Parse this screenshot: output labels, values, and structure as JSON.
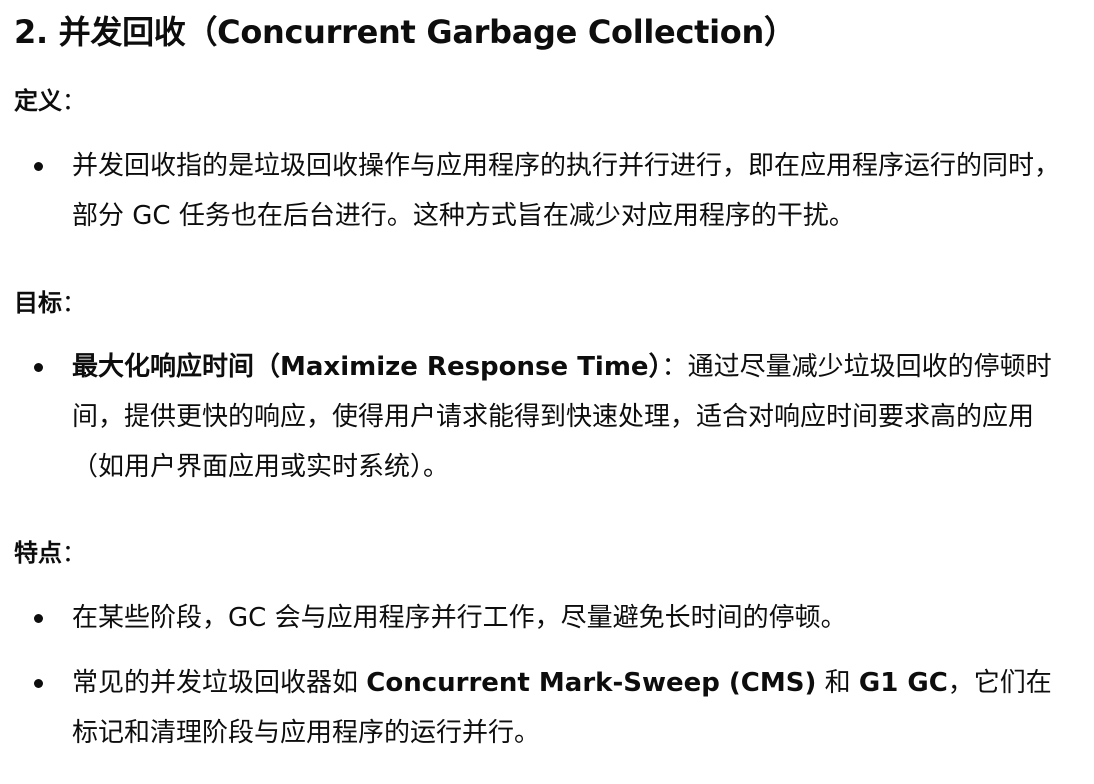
{
  "heading": "2. 并发回收（Concurrent Garbage Collection）",
  "sections": {
    "definition": {
      "label": "定义",
      "colon": "：",
      "items": [
        {
          "text": "并发回收指的是垃圾回收操作与应用程序的执行并行进行，即在应用程序运行的同时，部分 GC 任务也在后台进行。这种方式旨在减少对应用程序的干扰。"
        }
      ]
    },
    "goal": {
      "label": "目标",
      "colon": "：",
      "items": [
        {
          "bold": "最大化响应时间（Maximize Response Time）",
          "rest": "：通过尽量减少垃圾回收的停顿时间，提供更快的响应，使得用户请求能得到快速处理，适合对响应时间要求高的应用（如用户界面应用或实时系统）。"
        }
      ]
    },
    "features": {
      "label": "特点",
      "colon": "：",
      "items": [
        {
          "text": "在某些阶段，GC 会与应用程序并行工作，尽量避免长时间的停顿。"
        },
        {
          "pre": "常见的并发垃圾回收器如 ",
          "bold1": "Concurrent Mark-Sweep (CMS)",
          "mid": " 和 ",
          "bold2": "G1 GC",
          "post": "，它们在标记和清理阶段与应用程序的运行并行。"
        }
      ]
    }
  }
}
